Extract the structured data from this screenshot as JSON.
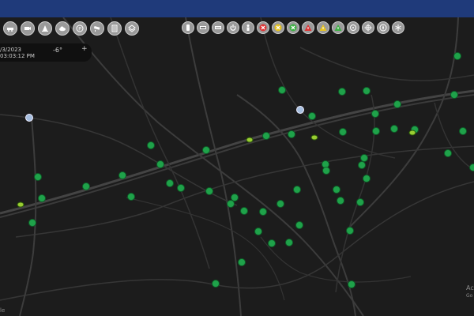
{
  "window": {
    "header_color": "#1f3a7a",
    "map_background": "#1c1c1c",
    "road_color": "#3c3c3c"
  },
  "toolbar_left": [
    {
      "name": "car-icon"
    },
    {
      "name": "traffic-camera-icon"
    },
    {
      "name": "traffic-cone-icon"
    },
    {
      "name": "weather-cloud-icon"
    },
    {
      "name": "parking-icon"
    },
    {
      "name": "security-camera-icon"
    },
    {
      "name": "message-sign-icon"
    },
    {
      "name": "map-layer-icon"
    }
  ],
  "toolbar_right": [
    {
      "name": "phone-icon"
    },
    {
      "name": "display-sign-icon"
    },
    {
      "name": "dms-icon"
    },
    {
      "name": "power-icon"
    },
    {
      "name": "person-icon"
    },
    {
      "name": "incident-red-x-icon"
    },
    {
      "name": "incident-yellow-x-icon"
    },
    {
      "name": "incident-green-x-icon"
    },
    {
      "name": "warning-red-icon"
    },
    {
      "name": "warning-yellow-icon"
    },
    {
      "name": "warning-green-icon"
    },
    {
      "name": "target-icon"
    },
    {
      "name": "crosshair-icon"
    },
    {
      "name": "compass-icon"
    },
    {
      "name": "snowflake-icon"
    }
  ],
  "info": {
    "date": "/3/2023",
    "time": "03:03:12 PM",
    "temperature": "-6°",
    "plus": "+"
  },
  "corner": {
    "line1": "Ac",
    "line2": "Go",
    "line3": "le"
  },
  "marker_colors": {
    "sensor": "#1fa24a",
    "device": "#a7bfe0",
    "vehicle": "#9acd32"
  }
}
